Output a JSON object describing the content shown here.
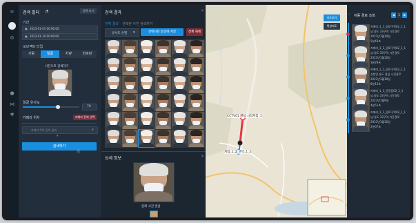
{
  "left_panel": {
    "title": "검색 필터",
    "reset_label": "검색 초기",
    "period_label": "기간",
    "date_from": "2023-01-01 00:00:00",
    "date_to": "2023-01-10 00:00:00",
    "object_section_label": "오브젝트 타입",
    "object_tabs": [
      "사람",
      "얼굴",
      "차량",
      "번호판"
    ],
    "image_search_label": "사진으로 검색하기",
    "similarity_label": "얼굴 유사도",
    "similarity_value": "70",
    "similarity_fraction": 0.62,
    "camera_section_label": "카메라 위치",
    "camera_select_label": "카메라 전체 선택",
    "camera_search_placeholder": "카메라 목록 검색 결과",
    "search_button": "검색하기"
  },
  "results_panel": {
    "title": "검색 결과",
    "tabs": [
      "전체 결과",
      "선택된 사진 검색하기"
    ],
    "sort_label": "유사도 순별",
    "action_primary": "선택사진 동선에 저장",
    "action_secondary": "전체 해제",
    "grid_rows": 6,
    "grid_cols": 6
  },
  "detail_panel": {
    "title": "상세 정보",
    "caption": "원래 사진 얼굴"
  },
  "map": {
    "legend_items": [
      "지도보기",
      "위성지도"
    ],
    "route_labels": [
      "CCTV01 영상 시작지점_1",
      "지점_1_2_구역_1_2"
    ]
  },
  "timeline_panel": {
    "title": "이동 경로 조회",
    "page_controls": [
      "◀",
      "1",
      "▶"
    ],
    "items": [
      {
        "line1": "카메라_1_1_경로구역02_1_1",
        "line2": "남:경도 33구역 시간경로",
        "line3": "2023년1월10일",
        "line4": "5분43초"
      },
      {
        "line1": "카메라_1_1_경로구역02_1_1",
        "line2": "남:경도 33구역 시간경로",
        "line3": "2023년1월10일",
        "line4": "3분29초"
      },
      {
        "line1": "카메라_1_1_경로구역02_1_1",
        "line2": "신청영 송도 중심 시간경로",
        "line3": "2023년1월10일",
        "line4": "8분15초"
      },
      {
        "line1": "카메라_1_1_운동장02_1_1",
        "line2": "남:경도 33구역 시간경로",
        "line3": "2023년1월9일",
        "line4": "4분51초"
      },
      {
        "line1": "카메라_1_1_경로구역02_1_1",
        "line2": "남:경도 33구역 기간경로",
        "line3": "2023년1월10일",
        "line4": "2분07초"
      }
    ]
  },
  "colors": {
    "accent": "#1a8fe0",
    "danger": "#d8343a",
    "panel": "#222e3b"
  }
}
